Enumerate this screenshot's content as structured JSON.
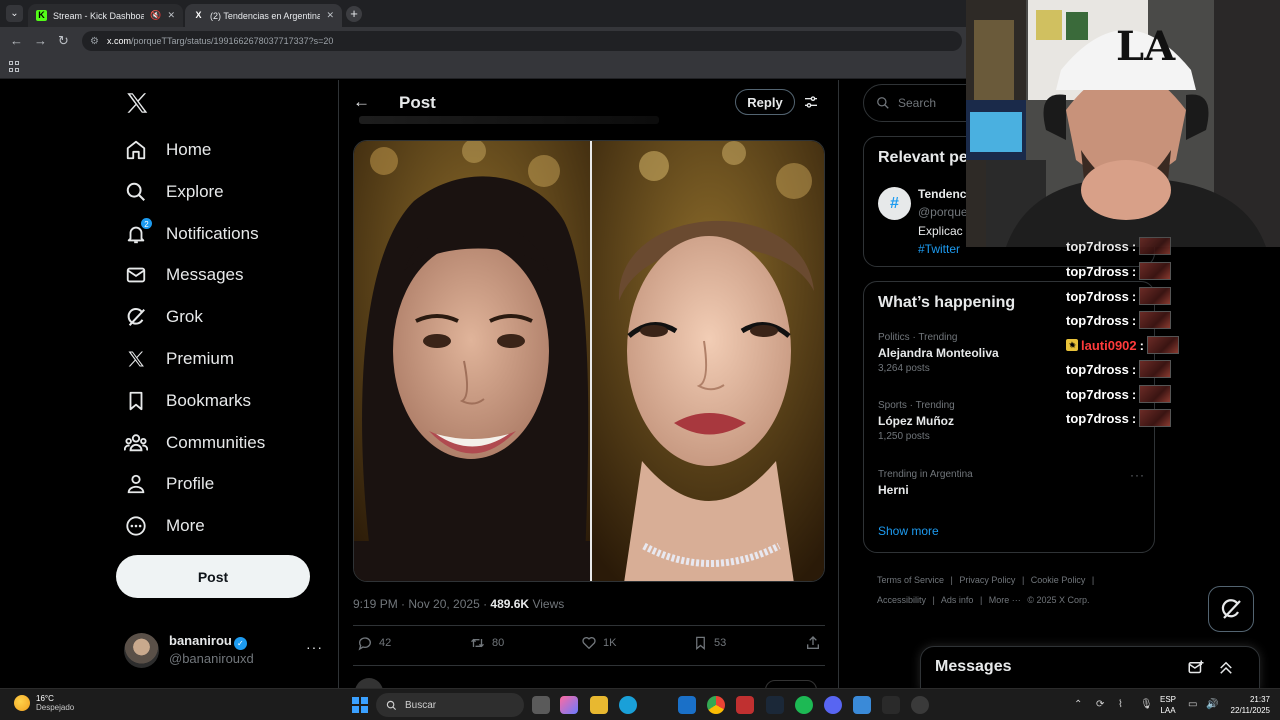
{
  "browser": {
    "tabs": [
      {
        "label": "Stream - Kick Dashboard",
        "favicon": "K",
        "favicon_color": "#53fc18"
      },
      {
        "label": "(2) Tendencias en Argentina on",
        "favicon": "X",
        "favicon_color": "#ffffff"
      }
    ],
    "url_host": "x.com",
    "url_path": "/porqueTTarg/status/1991662678037717337?s=20"
  },
  "nav": {
    "items": [
      {
        "label": "Home",
        "icon": "home-icon"
      },
      {
        "label": "Explore",
        "icon": "search-icon"
      },
      {
        "label": "Notifications",
        "icon": "bell-icon",
        "badge": "2"
      },
      {
        "label": "Messages",
        "icon": "mail-icon"
      },
      {
        "label": "Grok",
        "icon": "grok-icon"
      },
      {
        "label": "Premium",
        "icon": "x-icon"
      },
      {
        "label": "Bookmarks",
        "icon": "bookmark-icon"
      },
      {
        "label": "Communities",
        "icon": "people-icon"
      },
      {
        "label": "Profile",
        "icon": "person-icon"
      },
      {
        "label": "More",
        "icon": "more-circle-icon"
      }
    ],
    "post_button": "Post",
    "user": {
      "name": "bananirou",
      "handle": "@bananirouxd"
    }
  },
  "main": {
    "header_title": "Post",
    "reply_button": "Reply",
    "meta": {
      "time": "9:19 PM · Nov 20, 2025 · ",
      "views_count": "489.6K",
      "views_label": " Views"
    },
    "actions": {
      "replies": "42",
      "reposts": "80",
      "likes": "1K",
      "bookmarks": "53"
    }
  },
  "right": {
    "search_placeholder": "Search",
    "relevant": {
      "title": "Relevant pe",
      "name": "Tendenc",
      "handle": "@porque",
      "bio": "Explicac",
      "link": "#Twitter"
    },
    "happening": {
      "title": "What’s happening",
      "trends": [
        {
          "context": "Politics · Trending",
          "title": "Alejandra Monteoliva",
          "posts": "3,264 posts"
        },
        {
          "context": "Sports · Trending",
          "title": "López Muñoz",
          "posts": "1,250 posts"
        },
        {
          "context": "Trending in Argentina",
          "title": "Herni",
          "posts": ""
        }
      ],
      "show_more": "Show more"
    },
    "footer": [
      "Terms of Service",
      "|",
      "Privacy Policy",
      "|",
      "Cookie Policy",
      "|",
      "Accessibility",
      "|",
      "Ads info",
      "|",
      "More ···",
      "© 2025 X Corp."
    ]
  },
  "messages_drawer": {
    "title": "Messages"
  },
  "chat": [
    {
      "user": "top7dross",
      "color": "#ffffff"
    },
    {
      "user": "top7dross",
      "color": "#ffffff"
    },
    {
      "user": "top7dross",
      "color": "#ffffff"
    },
    {
      "user": "top7dross",
      "color": "#ffffff"
    },
    {
      "user": "lauti0902",
      "color": "#ff3b3b"
    },
    {
      "user": "top7dross",
      "color": "#ffffff"
    },
    {
      "user": "top7dross",
      "color": "#ffffff"
    },
    {
      "user": "top7dross",
      "color": "#ffffff"
    }
  ],
  "taskbar": {
    "temp": "16°C",
    "weather": "Despejado",
    "search": "Buscar",
    "lang1": "ESP",
    "lang2": "LAA",
    "time": "21:37",
    "date": "22/11/2025"
  }
}
